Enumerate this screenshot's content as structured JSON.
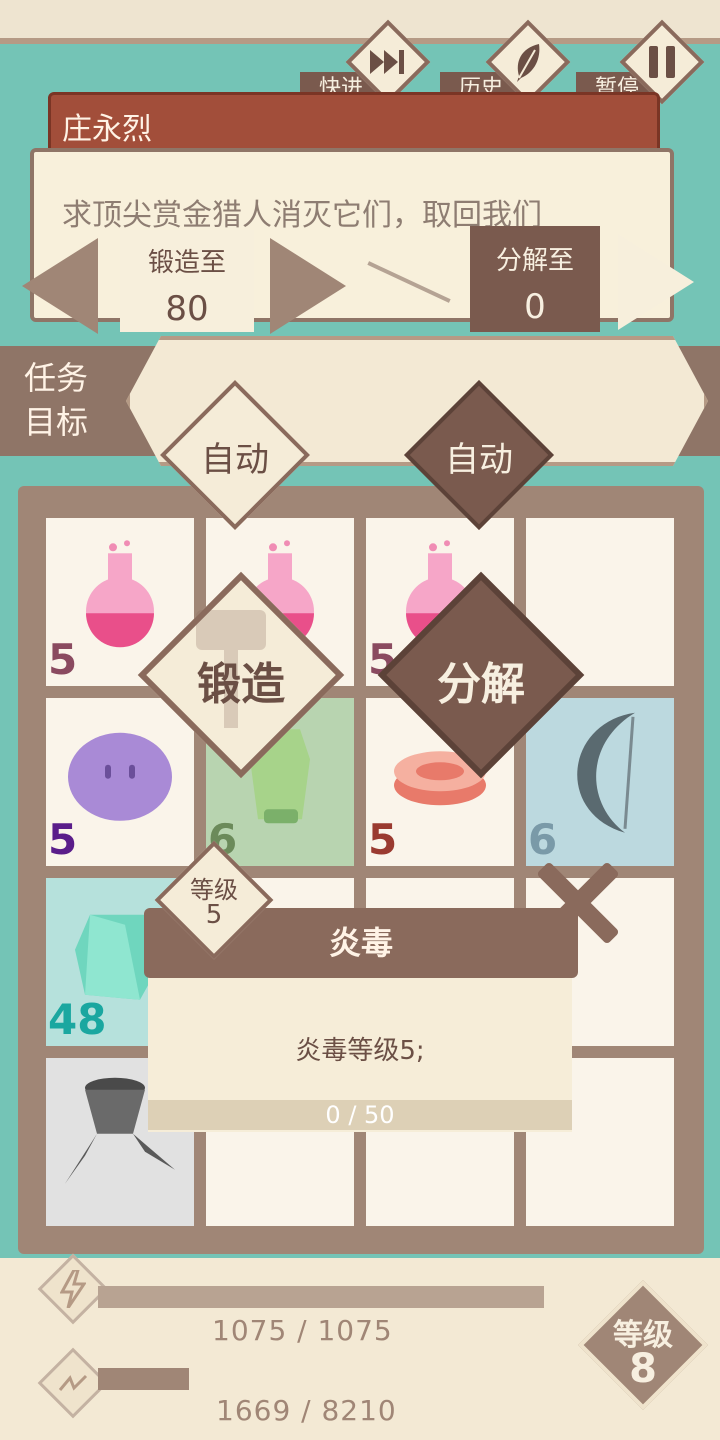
{
  "controls": {
    "fast_forward": {
      "label": "快进",
      "icon": "fast-forward-icon"
    },
    "history": {
      "label": "历史",
      "icon": "feather-icon"
    },
    "pause": {
      "label": "暂停",
      "icon": "pause-icon"
    }
  },
  "dialog": {
    "speaker": "庄永烈",
    "text": "求顶尖赏金猎人消灭它们，取回我们"
  },
  "forge_selector": {
    "forge_to_label": "锻造至",
    "forge_to_value": "80",
    "decompose_to_label": "分解至",
    "decompose_to_value": "0"
  },
  "task": {
    "label_line1": "任务",
    "label_line2": "目标"
  },
  "actions": {
    "auto_left": "自动",
    "auto_right": "自动",
    "forge": "锻造",
    "decompose": "分解"
  },
  "inventory": {
    "items": [
      {
        "name": "pink-potion",
        "count": "5",
        "count_color": "#8a4a60"
      },
      {
        "name": "pink-potion",
        "count": "",
        "count_color": "#8a4a60"
      },
      {
        "name": "pink-potion",
        "count": "5",
        "count_color": "#8a4a60"
      },
      {
        "name": "empty",
        "count": "",
        "count_color": "#000000"
      },
      {
        "name": "purple-slime",
        "count": "5",
        "count_color": "#5a1d8a"
      },
      {
        "name": "green-armor",
        "count": "6",
        "count_color": "#6b8a5a"
      },
      {
        "name": "red-disc",
        "count": "5",
        "count_color": "#9a3a30"
      },
      {
        "name": "crescent-bow",
        "count": "6",
        "count_color": "#7a9aa8"
      },
      {
        "name": "teal-crystal",
        "count": "48",
        "count_color": "#1aa7a0"
      },
      {
        "name": "empty",
        "count": "",
        "count_color": "#000000"
      },
      {
        "name": "empty",
        "count": "",
        "count_color": "#000000"
      },
      {
        "name": "empty",
        "count": "",
        "count_color": "#000000"
      },
      {
        "name": "iron-claw",
        "count": "",
        "count_color": "#000000"
      },
      {
        "name": "empty",
        "count": "",
        "count_color": "#000000"
      },
      {
        "name": "empty",
        "count": "",
        "count_color": "#000000"
      },
      {
        "name": "empty",
        "count": "",
        "count_color": "#000000"
      }
    ]
  },
  "tooltip": {
    "level_label": "等级",
    "level_value": "5",
    "title": "炎毒",
    "description": "炎毒等级5;",
    "progress_text": "0 / 50",
    "progress": 0
  },
  "bottom": {
    "energy_icon": "lightning-icon",
    "energy_text": "1075 / 1075",
    "energy_fill": 1.0,
    "exp_icon": "zigzag-icon",
    "exp_text": "1669 / 8210",
    "exp_fill": 0.203,
    "player_level_label": "等级",
    "player_level_value": "8"
  },
  "colors": {
    "background": "#74c4b6",
    "panel": "#f8f0db",
    "brown": "#8a6a5c",
    "dark_brown": "#7a5a4e",
    "red_card": "#a24e3a"
  }
}
